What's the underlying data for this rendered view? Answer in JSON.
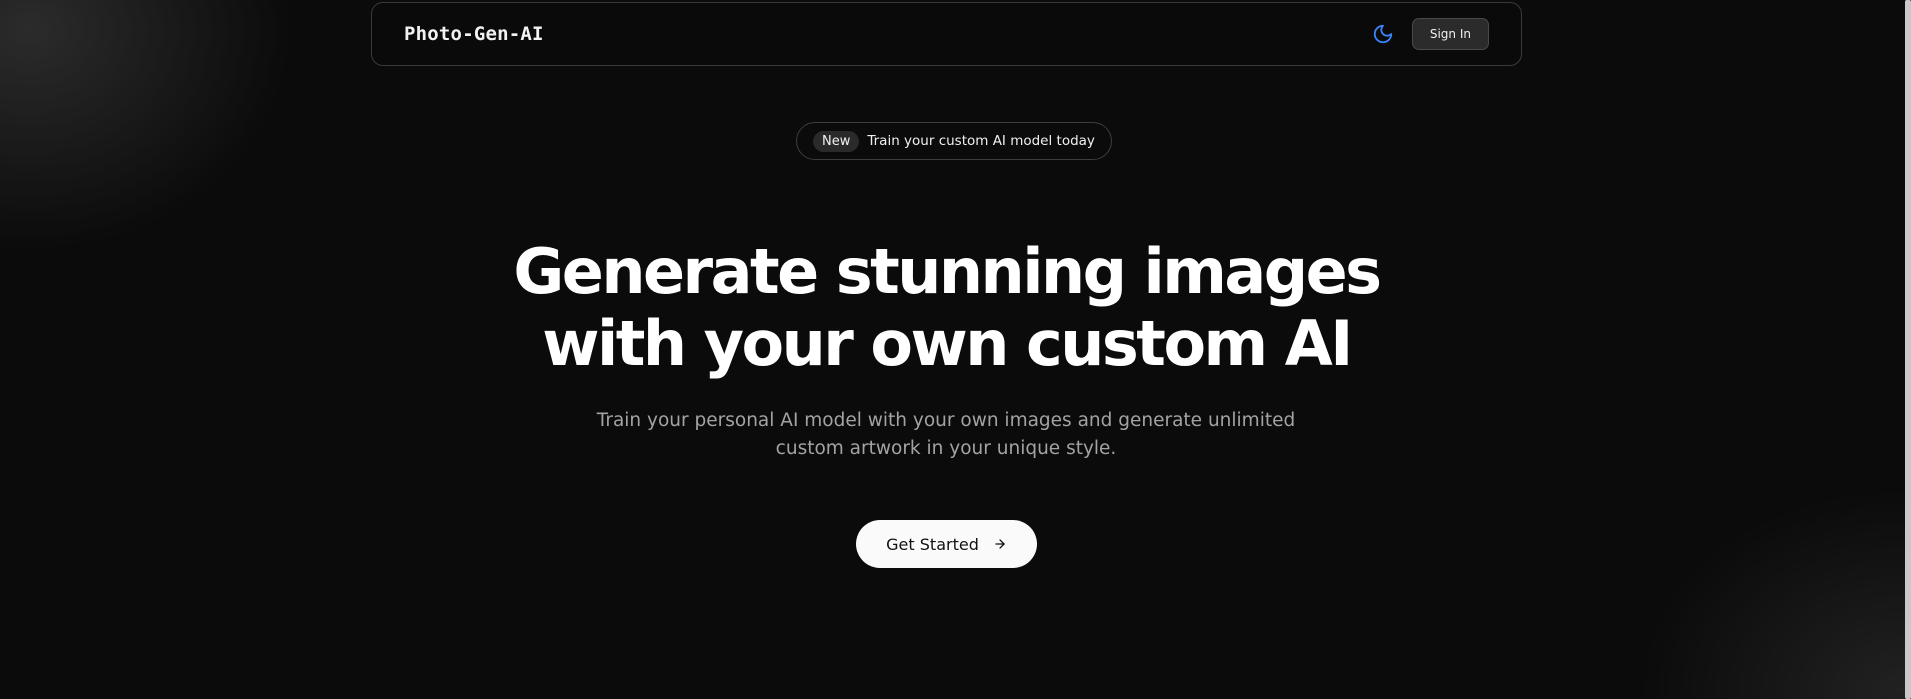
{
  "navbar": {
    "brand": "Photo-Gen-AI",
    "theme_toggle_icon": "moon-icon",
    "sign_in_label": "Sign In"
  },
  "announcement": {
    "badge": "New",
    "text": "Train your custom AI model today"
  },
  "hero": {
    "title_line1": "Generate stunning images",
    "title_line2": "with your own custom AI",
    "subtitle_line1": "Train your personal AI model with your own images and generate unlimited",
    "subtitle_line2": "custom artwork in your unique style.",
    "cta_label": "Get Started",
    "cta_icon": "arrow-right-icon"
  },
  "colors": {
    "background": "#0b0b0b",
    "accent_icon": "#3b82f6",
    "cta_background": "#fafafa",
    "muted_text": "#a3a3a3"
  }
}
